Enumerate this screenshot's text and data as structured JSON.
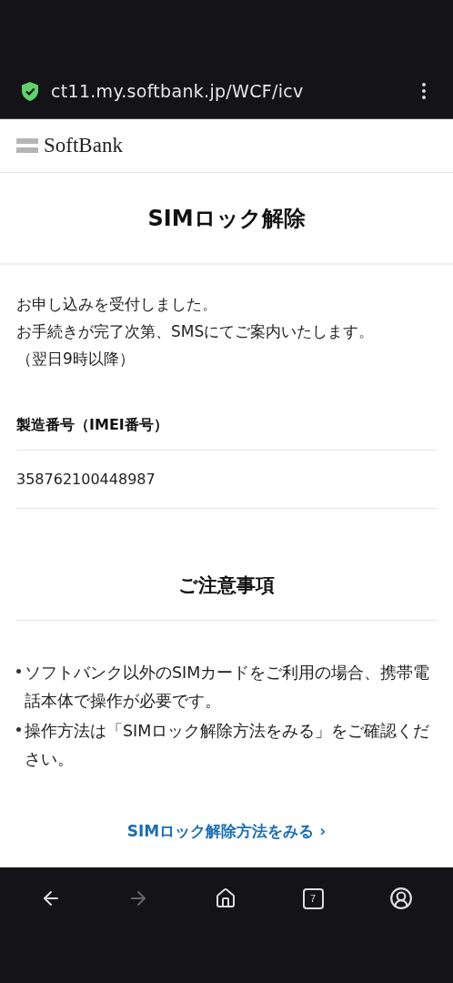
{
  "browser": {
    "url": "ct11.my.softbank.jp/WCF/icv",
    "tab_count": "7"
  },
  "header": {
    "logo": "SoftBank"
  },
  "page_title": "SIMロック解除",
  "message": [
    "お申し込みを受付しました。",
    "お手続きが完了次第、SMSにてご案内いたします。",
    "（翌日9時以降）"
  ],
  "imei": {
    "label": "製造番号（IMEI番号）",
    "value": "358762100448987"
  },
  "notes": {
    "heading": "ご注意事項",
    "items": [
      "ソフトバンク以外のSIMカードをご利用の場合、携帯電話本体で操作が必要です。",
      "操作方法は「SIMロック解除方法をみる」をご確認ください。"
    ]
  },
  "link": {
    "label": "SIMロック解除方法をみる",
    "chevron": "›"
  },
  "nav": [
    {
      "kind": "back",
      "disabled": false
    },
    {
      "kind": "forward",
      "disabled": true
    },
    {
      "kind": "home",
      "disabled": false
    },
    {
      "kind": "tabs",
      "disabled": false
    },
    {
      "kind": "account",
      "disabled": false
    }
  ]
}
